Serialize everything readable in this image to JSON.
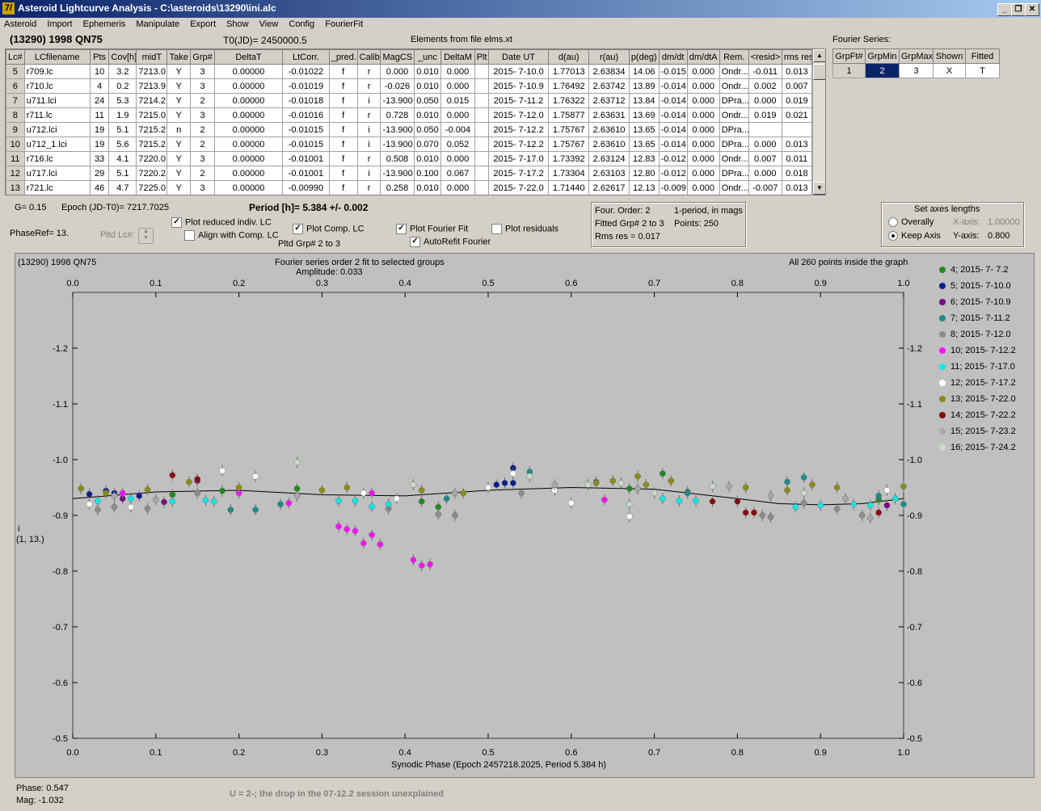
{
  "window": {
    "title": "Asteroid Lightcurve Analysis - C:\\asteroids\\13290\\ini.alc",
    "icon_glyph": "7/"
  },
  "menu": [
    "Asteroid",
    "Import",
    "Ephemeris",
    "Manipulate",
    "Export",
    "Show",
    "View",
    "Config",
    "FourierFit"
  ],
  "header": {
    "asteroid": "(13290) 1998 QN75",
    "t0": "T0(JD)= 2450000.5",
    "elements": "Elements from file elms.xt"
  },
  "lc_table": {
    "columns": [
      "Lc#",
      "LCfilename",
      "Pts",
      "Cov[h]",
      "midT",
      "Take",
      "Grp#",
      "DeltaT",
      "LtCorr.",
      "_pred.",
      "Calib.",
      "MagCS",
      "_unc",
      "DeltaM",
      "Plt",
      "Date UT",
      "d(au)",
      "r(au)",
      "p(deg)",
      "dm/dt",
      "dm/dtA",
      "Rem.",
      "<resid>",
      "rms res"
    ],
    "rows": [
      [
        "5",
        "r709.lc",
        "10",
        "3.2",
        "7213.0",
        "Y",
        "3",
        "0.00000",
        "-0.01022",
        "f",
        "r",
        "0.000",
        "0.010",
        "0.000",
        "",
        "2015- 7-10.0",
        "1.77013",
        "2.63834",
        "14.06",
        "-0.015",
        "0.000",
        "Ondr...",
        "-0.011",
        "0.013"
      ],
      [
        "6",
        "r710.lc",
        "4",
        "0.2",
        "7213.9",
        "Y",
        "3",
        "0.00000",
        "-0.01019",
        "f",
        "r",
        "-0.026",
        "0.010",
        "0.000",
        "",
        "2015- 7-10.9",
        "1.76492",
        "2.63742",
        "13.89",
        "-0.014",
        "0.000",
        "Ondr...",
        "0.002",
        "0.007"
      ],
      [
        "7",
        "u711.lci",
        "24",
        "5.3",
        "7214.2",
        "Y",
        "2",
        "0.00000",
        "-0.01018",
        "f",
        "i",
        "-13.900",
        "0.050",
        "0.015",
        "",
        "2015- 7-11.2",
        "1.76322",
        "2.63712",
        "13.84",
        "-0.014",
        "0.000",
        "DPra...",
        "0.000",
        "0.019"
      ],
      [
        "8",
        "r711.lc",
        "11",
        "1.9",
        "7215.0",
        "Y",
        "3",
        "0.00000",
        "-0.01016",
        "f",
        "r",
        "0.728",
        "0.010",
        "0.000",
        "",
        "2015- 7-12.0",
        "1.75877",
        "2.63631",
        "13.69",
        "-0.014",
        "0.000",
        "Ondr...",
        "0.019",
        "0.021"
      ],
      [
        "9",
        "u712.lci",
        "19",
        "5.1",
        "7215.2",
        "n",
        "2",
        "0.00000",
        "-0.01015",
        "f",
        "i",
        "-13.900",
        "0.050",
        "-0.004",
        "",
        "2015- 7-12.2",
        "1.75767",
        "2.63610",
        "13.65",
        "-0.014",
        "0.000",
        "DPra...",
        "",
        ""
      ],
      [
        "10",
        "u712_1.lci",
        "19",
        "5.6",
        "7215.2",
        "Y",
        "2",
        "0.00000",
        "-0.01015",
        "f",
        "i",
        "-13.900",
        "0.070",
        "0.052",
        "",
        "2015- 7-12.2",
        "1.75767",
        "2.63610",
        "13.65",
        "-0.014",
        "0.000",
        "DPra...",
        "0.000",
        "0.013"
      ],
      [
        "11",
        "r716.lc",
        "33",
        "4.1",
        "7220.0",
        "Y",
        "3",
        "0.00000",
        "-0.01001",
        "f",
        "r",
        "0.508",
        "0.010",
        "0.000",
        "",
        "2015- 7-17.0",
        "1.73392",
        "2.63124",
        "12.83",
        "-0.012",
        "0.000",
        "Ondr...",
        "0.007",
        "0.011"
      ],
      [
        "12",
        "u717.lci",
        "29",
        "5.1",
        "7220.2",
        "Y",
        "2",
        "0.00000",
        "-0.01001",
        "f",
        "i",
        "-13.900",
        "0.100",
        "0.067",
        "",
        "2015- 7-17.2",
        "1.73304",
        "2.63103",
        "12.80",
        "-0.012",
        "0.000",
        "DPra...",
        "0.000",
        "0.018"
      ],
      [
        "13",
        "r721.lc",
        "46",
        "4.7",
        "7225.0",
        "Y",
        "3",
        "0.00000",
        "-0.00990",
        "f",
        "r",
        "0.258",
        "0.010",
        "0.000",
        "",
        "2015- 7-22.0",
        "1.71440",
        "2.62617",
        "12.13",
        "-0.009",
        "0.000",
        "Ondr...",
        "-0.007",
        "0.013"
      ]
    ]
  },
  "fourier_table": {
    "title": "Fourier Series:",
    "columns": [
      "GrpFt#",
      "GrpMin",
      "GrpMax",
      "Shown",
      "Fitted"
    ],
    "row": [
      "1",
      "2",
      "3",
      "X",
      "T"
    ]
  },
  "params": {
    "g": "G= 0.15",
    "epoch": "Epoch (JD-T0)= 7217.7025",
    "period": "Period [h]= 5.384 +/- 0.002",
    "phaseref": "PhaseRef= 13.",
    "pltd_lc": "Pltd Lc#:",
    "plot_reduced": "Plot reduced indiv. LC",
    "align_comp": "Align with Comp. LC",
    "plot_comp": "Plot Comp. LC",
    "pltd_grp": "Pltd Grp#  2  to   3",
    "plot_fourier": "Plot Fourier Fit",
    "autorefit": "AutoRefit Fourier",
    "plot_resid": "Plot residuals"
  },
  "fit_info": {
    "order": "Four. Order:  2",
    "period_note": "1-period, in mags",
    "fitted": "Fitted Grp# 2 to 3",
    "points": "Points: 250",
    "rms": "Rms res     = 0.017"
  },
  "axes_box": {
    "title": "Set axes lengths",
    "overally": "Overally",
    "keep": "Keep Axis",
    "xaxis_label": "X-axis:",
    "xaxis_val": "1.00000",
    "yaxis_label": "Y-axis:",
    "yaxis_val": "0.800"
  },
  "plot": {
    "name": "(13290) 1998 QN75",
    "subtitle1": "Fourier series order 2 fit to selected groups",
    "subtitle2": "Amplitude: 0.033",
    "note": "All 260 points inside the graph",
    "ylabel1": "i",
    "ylabel2": "(1, 13.)",
    "xlabel": "Synodic Phase (Epoch 2457218.2025, Period 5.384 h)"
  },
  "chart_data": {
    "type": "scatter",
    "x_ticks": [
      "0.0",
      "0.1",
      "0.2",
      "0.3",
      "0.4",
      "0.5",
      "0.6",
      "0.7",
      "0.8",
      "0.9",
      "1.0"
    ],
    "y_ticks": [
      "-1.2",
      "-1.1",
      "-1.0",
      "-0.9",
      "-0.8",
      "-0.7",
      "-0.6",
      "-0.5"
    ],
    "xlim": [
      0.0,
      1.0
    ],
    "ylim": [
      -1.3,
      -0.5
    ],
    "y_inverted": true,
    "series": [
      {
        "name": "4; 2015- 7- 7.2",
        "color": "#1e8c1e",
        "points": [
          [
            0.12,
            -0.937
          ],
          [
            0.18,
            -0.944
          ],
          [
            0.27,
            -0.948
          ],
          [
            0.42,
            -0.925
          ],
          [
            0.44,
            -0.915
          ],
          [
            0.67,
            -0.948
          ],
          [
            0.71,
            -0.975
          ],
          [
            0.74,
            -0.942
          ],
          [
            0.97,
            -0.928
          ]
        ]
      },
      {
        "name": "5; 2015- 7-10.0",
        "color": "#0a1e8c",
        "points": [
          [
            0.02,
            -0.938
          ],
          [
            0.04,
            -0.944
          ],
          [
            0.05,
            -0.94
          ],
          [
            0.08,
            -0.935
          ],
          [
            0.51,
            -0.955
          ],
          [
            0.52,
            -0.958
          ],
          [
            0.53,
            -0.958
          ],
          [
            0.53,
            -0.985
          ]
        ]
      },
      {
        "name": "6; 2015- 7-10.9",
        "color": "#7a008c",
        "points": [
          [
            0.06,
            -0.93
          ],
          [
            0.11,
            -0.924
          ],
          [
            0.15,
            -0.962
          ],
          [
            0.98,
            -0.918
          ]
        ]
      },
      {
        "name": "7; 2015- 7-11.2",
        "color": "#1e8c8c",
        "points": [
          [
            0.19,
            -0.91
          ],
          [
            0.22,
            -0.91
          ],
          [
            0.25,
            -0.92
          ],
          [
            0.45,
            -0.93
          ],
          [
            0.55,
            -0.978
          ],
          [
            0.63,
            -0.96
          ],
          [
            0.74,
            -0.94
          ],
          [
            0.86,
            -0.96
          ],
          [
            0.88,
            -0.968
          ],
          [
            0.97,
            -0.935
          ],
          [
            1.0,
            -0.92
          ]
        ]
      },
      {
        "name": "8; 2015- 7-12.0",
        "color": "#8c8c8c",
        "points": [
          [
            0.03,
            -0.91
          ],
          [
            0.05,
            -0.915
          ],
          [
            0.09,
            -0.912
          ],
          [
            0.15,
            -0.94
          ],
          [
            0.38,
            -0.912
          ],
          [
            0.44,
            -0.902
          ],
          [
            0.46,
            -0.9
          ],
          [
            0.54,
            -0.94
          ],
          [
            0.83,
            -0.9
          ],
          [
            0.84,
            -0.897
          ],
          [
            0.88,
            -0.922
          ],
          [
            0.92,
            -0.912
          ],
          [
            0.95,
            -0.9
          ]
        ]
      },
      {
        "name": "10; 2015- 7-12.2",
        "color": "#ff14ff",
        "points": [
          [
            0.32,
            -0.88
          ],
          [
            0.33,
            -0.875
          ],
          [
            0.34,
            -0.872
          ],
          [
            0.35,
            -0.85
          ],
          [
            0.36,
            -0.865
          ],
          [
            0.37,
            -0.848
          ],
          [
            0.41,
            -0.82
          ],
          [
            0.42,
            -0.81
          ],
          [
            0.43,
            -0.812
          ],
          [
            0.06,
            -0.94
          ],
          [
            0.2,
            -0.94
          ],
          [
            0.26,
            -0.922
          ],
          [
            0.36,
            -0.94
          ],
          [
            0.64,
            -0.928
          ]
        ]
      },
      {
        "name": "11; 2015- 7-17.0",
        "color": "#14e6e6",
        "points": [
          [
            0.03,
            -0.926
          ],
          [
            0.07,
            -0.93
          ],
          [
            0.12,
            -0.925
          ],
          [
            0.16,
            -0.927
          ],
          [
            0.17,
            -0.925
          ],
          [
            0.32,
            -0.926
          ],
          [
            0.34,
            -0.926
          ],
          [
            0.36,
            -0.916
          ],
          [
            0.38,
            -0.92
          ],
          [
            0.71,
            -0.93
          ],
          [
            0.73,
            -0.926
          ],
          [
            0.75,
            -0.926
          ],
          [
            0.87,
            -0.915
          ],
          [
            0.9,
            -0.918
          ],
          [
            0.94,
            -0.92
          ],
          [
            0.96,
            -0.918
          ],
          [
            0.99,
            -0.93
          ]
        ]
      },
      {
        "name": "12; 2015- 7-17.2",
        "color": "#ffffff",
        "points": [
          [
            0.02,
            -0.92
          ],
          [
            0.07,
            -0.915
          ],
          [
            0.18,
            -0.98
          ],
          [
            0.22,
            -0.97
          ],
          [
            0.35,
            -0.94
          ],
          [
            0.39,
            -0.93
          ],
          [
            0.5,
            -0.95
          ],
          [
            0.53,
            -0.975
          ],
          [
            0.58,
            -0.945
          ],
          [
            0.6,
            -0.922
          ],
          [
            0.67,
            -0.898
          ],
          [
            0.98,
            -0.945
          ]
        ]
      },
      {
        "name": "13; 2015- 7-22.0",
        "color": "#8c8c14",
        "points": [
          [
            0.01,
            -0.948
          ],
          [
            0.04,
            -0.94
          ],
          [
            0.09,
            -0.946
          ],
          [
            0.14,
            -0.96
          ],
          [
            0.2,
            -0.95
          ],
          [
            0.3,
            -0.945
          ],
          [
            0.33,
            -0.95
          ],
          [
            0.42,
            -0.945
          ],
          [
            0.47,
            -0.94
          ],
          [
            0.63,
            -0.958
          ],
          [
            0.65,
            -0.962
          ],
          [
            0.68,
            -0.97
          ],
          [
            0.69,
            -0.955
          ],
          [
            0.72,
            -0.962
          ],
          [
            0.81,
            -0.95
          ],
          [
            0.86,
            -0.945
          ],
          [
            0.89,
            -0.955
          ],
          [
            0.92,
            -0.95
          ],
          [
            1.0,
            -0.952
          ]
        ]
      },
      {
        "name": "14; 2015- 7-22.2",
        "color": "#8c0a0a",
        "points": [
          [
            0.12,
            -0.972
          ],
          [
            0.15,
            -0.965
          ],
          [
            0.77,
            -0.925
          ],
          [
            0.8,
            -0.925
          ],
          [
            0.81,
            -0.905
          ],
          [
            0.82,
            -0.905
          ],
          [
            0.97,
            -0.905
          ]
        ]
      },
      {
        "name": "15; 2015- 7-23.2",
        "color": "#a8a8a8",
        "points": [
          [
            0.05,
            -0.935
          ],
          [
            0.1,
            -0.928
          ],
          [
            0.27,
            -0.935
          ],
          [
            0.46,
            -0.94
          ],
          [
            0.58,
            -0.955
          ],
          [
            0.68,
            -0.948
          ],
          [
            0.79,
            -0.952
          ],
          [
            0.84,
            -0.935
          ],
          [
            0.93,
            -0.93
          ],
          [
            0.96,
            -0.895
          ]
        ]
      },
      {
        "name": "16; 2015- 7-24.2",
        "color": "#c8dcc8",
        "points": [
          [
            0.27,
            -0.995
          ],
          [
            0.41,
            -0.955
          ],
          [
            0.55,
            -0.97
          ],
          [
            0.62,
            -0.955
          ],
          [
            0.66,
            -0.958
          ],
          [
            0.67,
            -0.92
          ],
          [
            0.7,
            -0.94
          ],
          [
            0.77,
            -0.952
          ],
          [
            0.88,
            -0.94
          ]
        ]
      }
    ],
    "fit_curve": {
      "name": "Fourier fit",
      "color": "#000000",
      "points": [
        [
          0.0,
          -0.93
        ],
        [
          0.1,
          -0.942
        ],
        [
          0.2,
          -0.945
        ],
        [
          0.3,
          -0.937
        ],
        [
          0.4,
          -0.935
        ],
        [
          0.5,
          -0.945
        ],
        [
          0.6,
          -0.95
        ],
        [
          0.7,
          -0.947
        ],
        [
          0.8,
          -0.93
        ],
        [
          0.85,
          -0.921
        ],
        [
          0.9,
          -0.919
        ],
        [
          0.95,
          -0.921
        ],
        [
          1.0,
          -0.93
        ]
      ]
    }
  },
  "footer": {
    "phase": "Phase:  0.547",
    "mag": "Mag:   -1.032",
    "comment": "U = 2-; the drop in the 07-12.2 session unexplained"
  }
}
